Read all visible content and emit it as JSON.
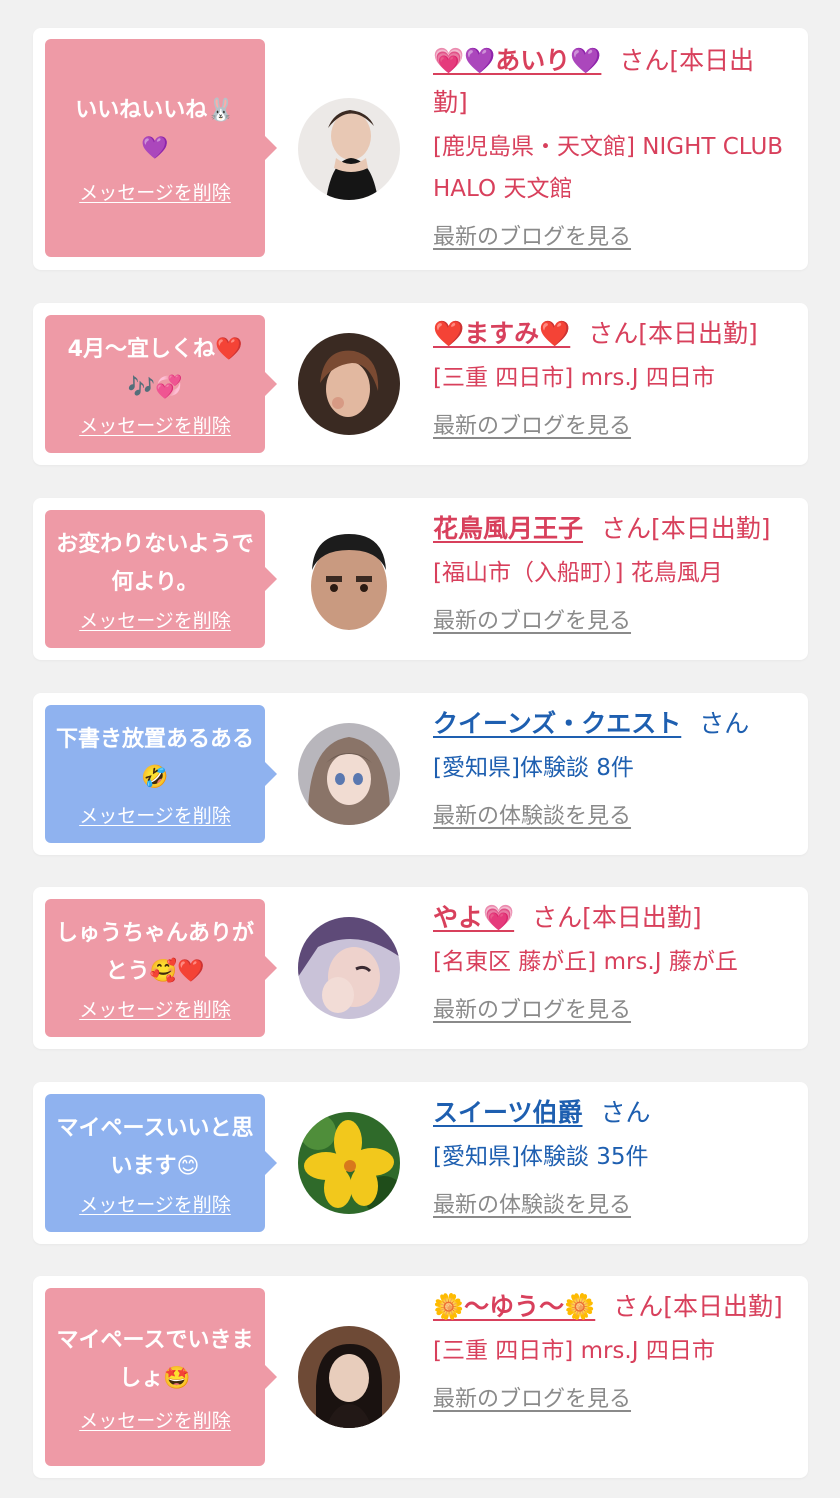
{
  "cards": [
    {
      "message": "いいねいいね🐰💜",
      "delete_label": "メッセージを削除",
      "name": "💗💜あいり💜",
      "honorific": "さん[本日出勤]",
      "shop": "[鹿児島県・天文館] NIGHT CLUB HALO 天文館",
      "more_link": "最新のブログを見る",
      "color": "#ee9aa6"
    },
    {
      "message": "4月〜宜しくね❤️🎶💞",
      "delete_label": "メッセージを削除",
      "name": "❤️ますみ❤️",
      "honorific": "さん[本日出勤]",
      "shop": "[三重 四日市] mrs.J 四日市",
      "more_link": "最新のブログを見る",
      "color": "#ee9aa6"
    },
    {
      "message": "お変わりないようで何より。",
      "delete_label": "メッセージを削除",
      "name": "花鳥風月王子",
      "honorific": "さん[本日出勤]",
      "shop": "[福山市（入船町）] 花鳥風月",
      "more_link": "最新のブログを見る",
      "color": "#ee9aa6"
    },
    {
      "message": "下書き放置あるある🤣",
      "delete_label": "メッセージを削除",
      "name": "クイーンズ・クエスト",
      "honorific": "さん",
      "shop": "[愛知県]体験談 8件",
      "more_link": "最新の体験談を見る",
      "color": "#8fb2ef"
    },
    {
      "message": "しゅうちゃんありがとう🥰❤️",
      "delete_label": "メッセージを削除",
      "name": "やよ💗",
      "honorific": "さん[本日出勤]",
      "shop": "[名東区 藤が丘] mrs.J 藤が丘",
      "more_link": "最新のブログを見る",
      "color": "#ee9aa6"
    },
    {
      "message": "マイペースいいと思います😊",
      "delete_label": "メッセージを削除",
      "name": "スイーツ伯爵",
      "honorific": "さん",
      "shop": "[愛知県]体験談 35件",
      "more_link": "最新の体験談を見る",
      "color": "#8fb2ef"
    },
    {
      "message": "マイペースでいきましょ🤩",
      "delete_label": "メッセージを削除",
      "name": "🌼〜ゆう〜🌼",
      "honorific": "さん[本日出勤]",
      "shop": "[三重 四日市] mrs.J 四日市",
      "more_link": "最新のブログを見る",
      "color": "#ee9aa6"
    }
  ]
}
